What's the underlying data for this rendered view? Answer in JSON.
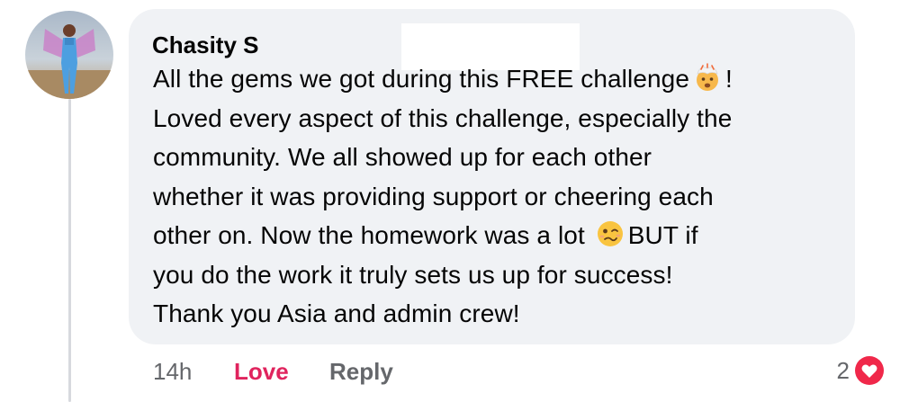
{
  "comment": {
    "author": "Chasity S",
    "body_lines": [
      [
        "All the gems we got during this FREE challenge",
        "!"
      ],
      [
        "Loved every aspect of this challenge, especially the"
      ],
      [
        "community. We all showed up for each other"
      ],
      [
        "whether it was providing support or cheering each"
      ],
      [
        "other on. Now the homework was a lot ",
        "BUT if"
      ],
      [
        "you do the work it truly sets us up for success!"
      ],
      [
        "Thank you Asia and admin crew!"
      ]
    ],
    "emojis": [
      "exploding-head-emoji",
      "woozy-face-emoji"
    ]
  },
  "actions": {
    "timestamp": "14h",
    "love_label": "Love",
    "reply_label": "Reply"
  },
  "reactions": {
    "count": "2",
    "icon": "heart-reaction-icon",
    "color": "#f0284a"
  },
  "colors": {
    "bubble": "#f0f2f5",
    "love": "#e0245e",
    "muted": "#65676b",
    "text": "#050505"
  }
}
